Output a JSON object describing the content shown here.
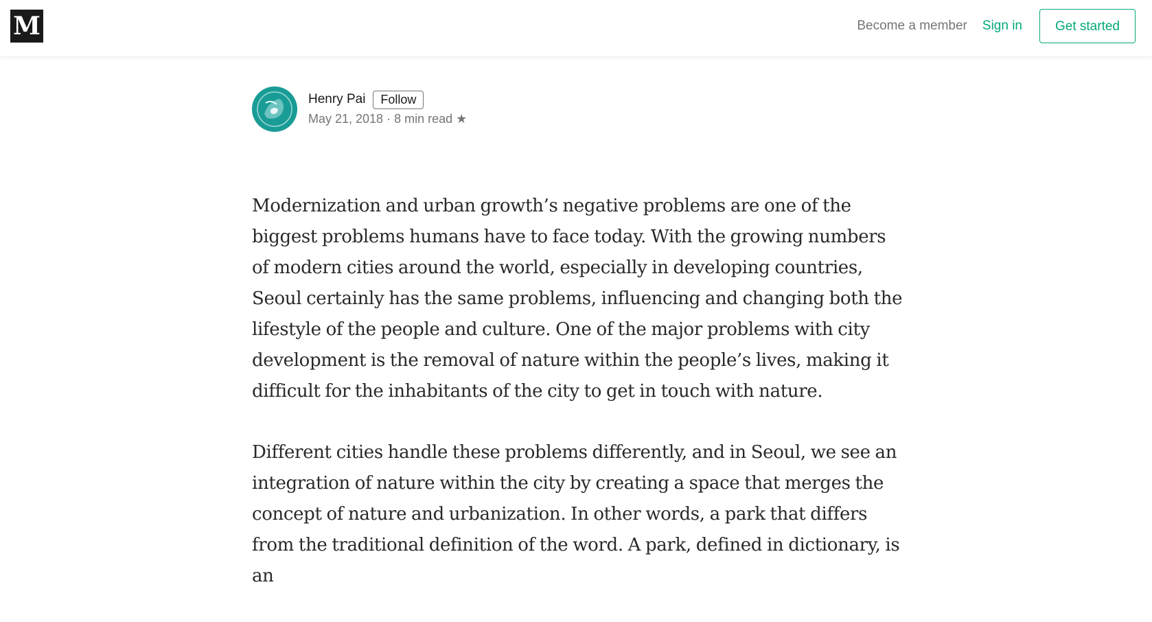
{
  "header": {
    "logo": "M",
    "become_member": "Become a member",
    "sign_in": "Sign in",
    "get_started": "Get started",
    "accent_color": "#03a87c"
  },
  "byline": {
    "author": "Henry Pai",
    "follow": "Follow",
    "date": "May 21, 2018",
    "separator": "·",
    "read_time": "8 min read",
    "star": "★"
  },
  "article": {
    "paragraphs": [
      "Modernization and urban growth’s negative problems are one of the biggest problems humans have to face today. With the growing numbers of modern cities around the world, especially in developing countries, Seoul certainly has the same problems, influencing and changing both the lifestyle of the people and culture. One of the major problems with city development is the removal of nature within the people’s lives, making it difficult for the inhabitants of the city to get in touch with nature.",
      "Different cities handle these problems differently, and in Seoul, we see an integration of nature within the city by creating a space that merges the concept of nature and urbanization. In other words, a park that differs from the traditional definition of the word. A park, defined in dictionary, is an"
    ]
  }
}
